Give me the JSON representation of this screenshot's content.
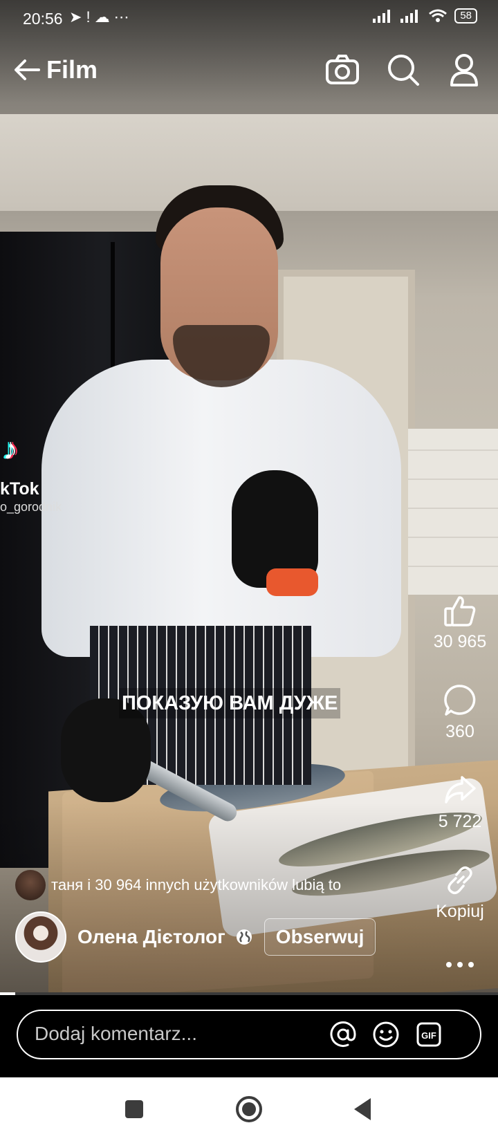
{
  "status_bar": {
    "time": "20:56",
    "left_icons": [
      "telegram-icon",
      "alert-icon",
      "cloud-icon",
      "more-icon"
    ],
    "right_icons": [
      "signal-icon",
      "signal-icon",
      "wifi-icon"
    ],
    "battery": "58"
  },
  "header": {
    "title": "Film",
    "icons": [
      "back-arrow-icon",
      "camera-icon",
      "search-icon",
      "profile-icon"
    ]
  },
  "video": {
    "watermark_brand": "kTok",
    "watermark_handle": "o_gorodnik",
    "caption": "ПОКАЗУЮ ВАМ ДУЖЕ",
    "progress": 0.03
  },
  "actions": {
    "like_count": "30 965",
    "comment_count": "360",
    "share_count": "5 722",
    "copy_label": "Kopiuj"
  },
  "likes_line": {
    "text": "таня і 30 964 innych użytkowników lubią to"
  },
  "author": {
    "name": "Олена Дієтолог",
    "follow_label": "Obserwuj"
  },
  "comment": {
    "placeholder": "Dodaj komentarz..."
  },
  "colors": {
    "overlay_text": "#ffffff",
    "strap_accent": "#e8582e",
    "navbar_bg": "#ffffff",
    "nav_icons": "#3c3c3c"
  }
}
